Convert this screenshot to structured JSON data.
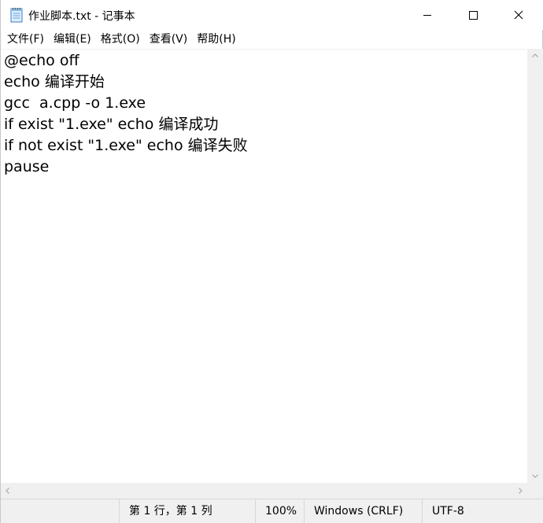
{
  "window": {
    "title": "作业脚本.txt - 记事本",
    "icon": "notepad-icon",
    "controls": {
      "minimize_icon": "minimize-icon",
      "maximize_icon": "maximize-icon",
      "close_icon": "close-icon"
    }
  },
  "menu": {
    "items": [
      {
        "label": "文件(F)"
      },
      {
        "label": "编辑(E)"
      },
      {
        "label": "格式(O)"
      },
      {
        "label": "查看(V)"
      },
      {
        "label": "帮助(H)"
      }
    ]
  },
  "editor": {
    "lines": [
      "@echo off",
      "echo 编译开始",
      "gcc  a.cpp -o 1.exe",
      "if exist \"1.exe\" echo 编译成功",
      "if not exist \"1.exe\" echo 编译失败",
      "pause"
    ]
  },
  "statusbar": {
    "position": "第 1 行，第 1 列",
    "zoom": "100%",
    "line_ending": "Windows (CRLF)",
    "encoding": "UTF-8"
  },
  "colors": {
    "background": "#ffffff",
    "chrome": "#f0f0f0",
    "text": "#000000"
  }
}
